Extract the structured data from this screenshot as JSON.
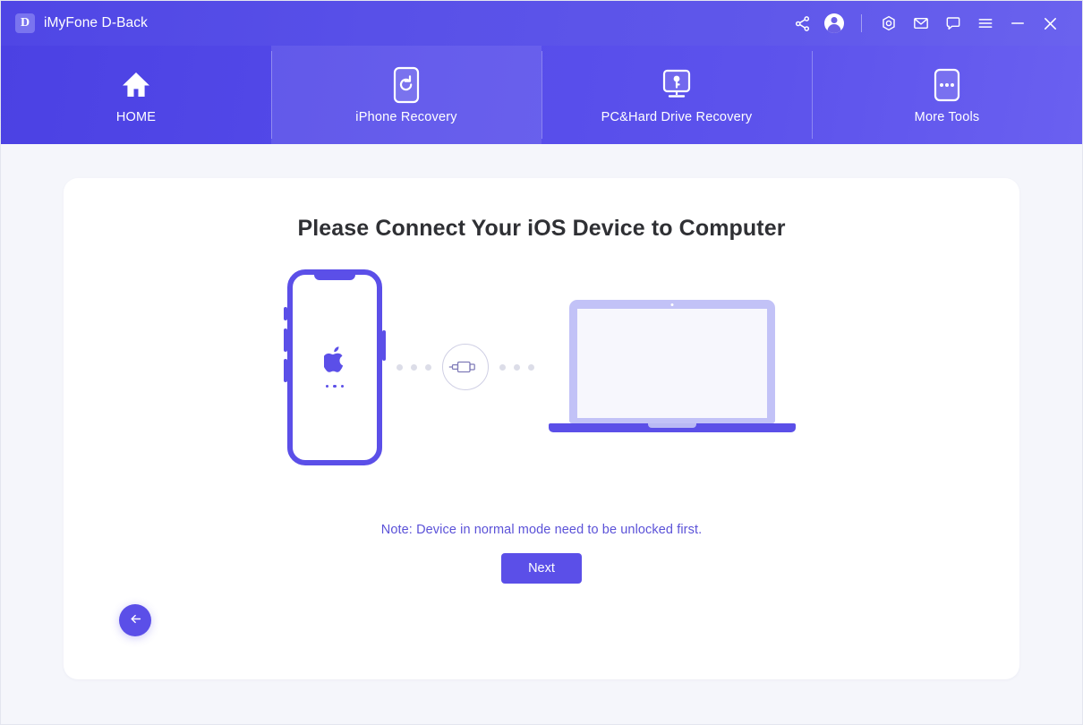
{
  "window": {
    "app_name": "iMyFone D-Back",
    "logo_letter": "D",
    "controls": {
      "share": "share-icon",
      "account": "account-avatar-icon",
      "settings": "settings-icon",
      "mail": "mail-icon",
      "feedback": "chat-icon",
      "menu": "hamburger-menu-icon",
      "minimize": "minimize-icon",
      "close": "close-icon"
    }
  },
  "nav": {
    "tabs": [
      {
        "label": "HOME",
        "icon": "home-icon",
        "active": false
      },
      {
        "label": "iPhone Recovery",
        "icon": "phone-refresh-icon",
        "active": true
      },
      {
        "label": "PC&Hard Drive Recovery",
        "icon": "monitor-key-icon",
        "active": false
      },
      {
        "label": "More Tools",
        "icon": "more-dots-icon",
        "active": false
      }
    ]
  },
  "main": {
    "title": "Please Connect Your iOS Device to Computer",
    "illustration": {
      "device_icon": "apple-logo",
      "connector_icon": "usb-connector-icon",
      "computer_icon": "laptop-icon"
    },
    "note": "Note: Device in normal mode need to be unlocked first.",
    "next_label": "Next",
    "back_icon": "arrow-left-icon"
  },
  "colors": {
    "brand_purple": "#5b4fe8",
    "header_gradient_start": "#4f46e5",
    "header_gradient_end": "#6a62ee",
    "note_text": "#5b52d8",
    "page_background": "#f5f6fb",
    "card_background": "#ffffff",
    "heading_text": "#2f3034"
  }
}
